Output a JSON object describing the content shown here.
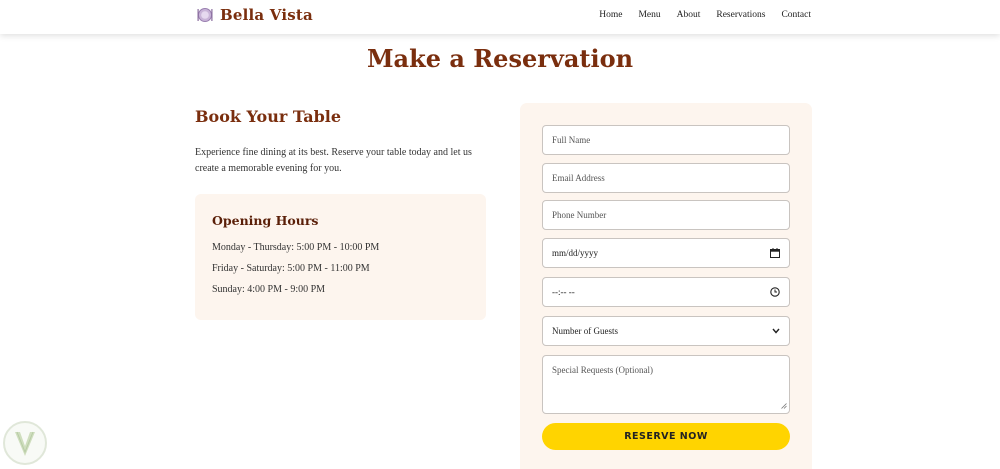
{
  "header": {
    "brand_icon": "plate-cutlery-icon",
    "brand_name": "Bella Vista",
    "nav": [
      "Home",
      "Menu",
      "About",
      "Reservations",
      "Contact"
    ]
  },
  "page_title": "Make a Reservation",
  "intro": {
    "heading": "Book Your Table",
    "description": "Experience fine dining at its best. Reserve your table today and let us create a memorable evening for you."
  },
  "hours": {
    "title": "Opening Hours",
    "lines": [
      "Monday - Thursday: 5:00 PM - 10:00 PM",
      "Friday - Saturday: 5:00 PM - 11:00 PM",
      "Sunday: 4:00 PM - 9:00 PM"
    ]
  },
  "form": {
    "full_name_placeholder": "Full Name",
    "email_placeholder": "Email Address",
    "phone_placeholder": "Phone Number",
    "date_value": "mm/dd/yyyy",
    "time_value": "--:-- --",
    "guests_selected": "Number of Guests",
    "requests_placeholder": "Special Requests (Optional)",
    "submit_label": "RESERVE NOW"
  },
  "colors": {
    "brand": "#7a2e0e",
    "panel_bg": "#fdf5ee",
    "button": "#ffd400"
  }
}
